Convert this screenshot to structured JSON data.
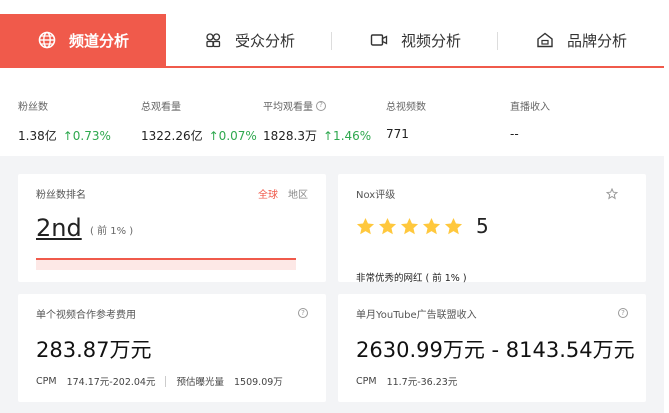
{
  "tabs": [
    {
      "label": "频道分析",
      "icon": "globe-icon",
      "active": true
    },
    {
      "label": "受众分析",
      "icon": "audience-icon",
      "active": false
    },
    {
      "label": "视频分析",
      "icon": "video-icon",
      "active": false
    },
    {
      "label": "品牌分析",
      "icon": "brand-icon",
      "active": false
    }
  ],
  "stats": [
    {
      "label": "粉丝数",
      "value": "1.38亿",
      "change": "↑0.73%"
    },
    {
      "label": "总观看量",
      "value": "1322.26亿",
      "change": "↑0.07%"
    },
    {
      "label": "平均观看量",
      "value": "1828.3万",
      "change": "↑1.46%"
    },
    {
      "label": "总视频数",
      "value": "771",
      "change": ""
    },
    {
      "label": "直播收入",
      "value": "--",
      "change": ""
    }
  ],
  "rank_card": {
    "title": "粉丝数排名",
    "tab_global": "全球",
    "tab_region": "地区",
    "value": "2nd",
    "note": "( 前 1% )"
  },
  "nox_card": {
    "title": "Nox评级",
    "stars": 5,
    "score": "5",
    "desc": "非常优秀的网红 ( 前 1% )"
  },
  "cost_card": {
    "title": "单个视频合作参考费用",
    "value": "283.87万元",
    "cpm_label": "CPM",
    "cpm_value": "174.17元-202.04元",
    "exposure_label": "预估曝光量",
    "exposure_value": "1509.09万"
  },
  "income_card": {
    "title": "单月YouTube广告联盟收入",
    "value": "2630.99万元 - 8143.54万元",
    "cpm_label": "CPM",
    "cpm_value": "11.7元-36.23元"
  },
  "colors": {
    "accent": "#f05a4b",
    "up": "#2ea84e",
    "star": "#ffc83d"
  }
}
